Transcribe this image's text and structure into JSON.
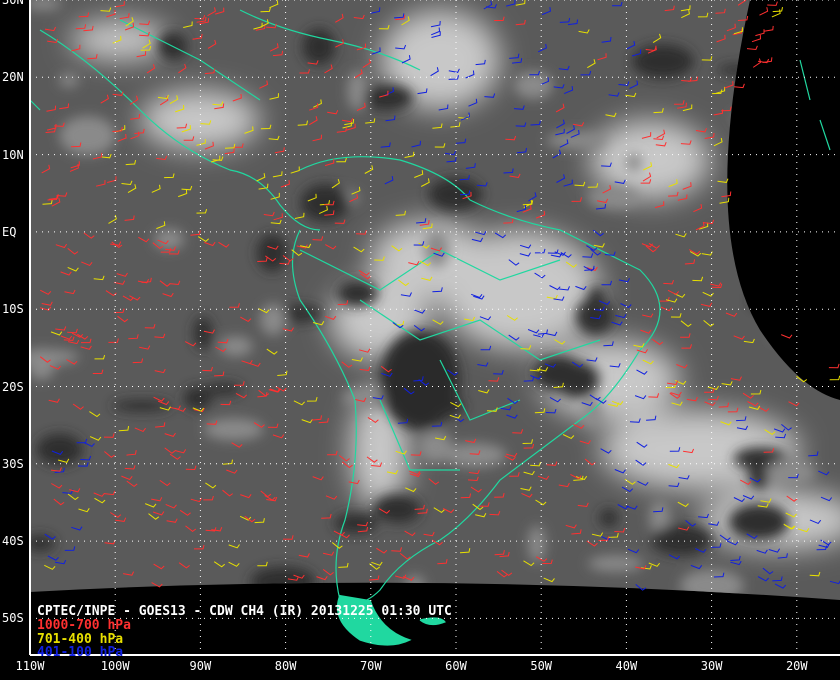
{
  "title": "CPTEC/INPE - GOES13 - CDW CH4 (IR) 20131225 01:30 UTC",
  "legend": [
    {
      "label": "1000-700 hPa",
      "color": "#ff3030"
    },
    {
      "label": "701-400 hPa",
      "color": "#e8e000"
    },
    {
      "label": "401-100 hPa",
      "color": "#1020e0"
    }
  ],
  "lat_labels": [
    "30N",
    "20N",
    "10N",
    "EQ",
    "10S",
    "20S",
    "30S",
    "40S",
    "50S"
  ],
  "lon_labels": [
    "110W",
    "100W",
    "90W",
    "80W",
    "70W",
    "60W",
    "50W",
    "40W",
    "30W",
    "20W"
  ],
  "colors": {
    "coast": "#20d8a0",
    "grid": "#ffffff",
    "background": "#000000"
  }
}
